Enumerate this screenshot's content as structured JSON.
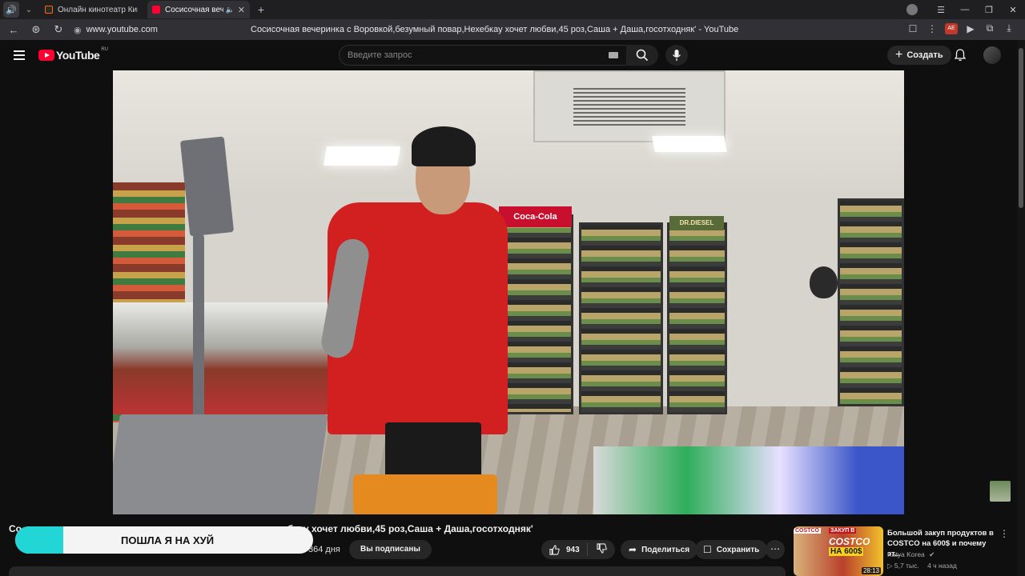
{
  "browser": {
    "tabs": [
      {
        "title": "Онлайн кинотеатр Кинопоиск",
        "active": false
      },
      {
        "title": "Сосисочная вечеринка",
        "active": true
      }
    ],
    "url": "www.youtube.com",
    "page_title": "Сосисочная вечеринка с Воровкой,безумный повар,Нехебкау хочет любви,45 роз,Саша + Даша,госотходняк' - YouTube",
    "extension_badge": "AE"
  },
  "masthead": {
    "logo_text": "YouTube",
    "region": "RU",
    "search_placeholder": "Введите запрос",
    "create_label": "Создать"
  },
  "video": {
    "title": "Сосисочная вечеринка с Воровкой,безумный повар,Нехебкау хочет любви,45 роз,Саша + Даша,госотходняк'",
    "title_visible_start": "Со",
    "title_visible_tail": "ребкау хочет любви,45 роз,Саша + Даша,госотходняк'",
    "overlay_text": "ПОШЛА Я НА ХУЙ",
    "age": "364 дня",
    "subscribed_label": "Вы подписаны",
    "likes": "943",
    "share_label": "Поделиться",
    "save_label": "Сохранить",
    "progress_fraction": 0.16,
    "overlay_bar_fill_fraction": 0.16
  },
  "recommendation": {
    "thumb_brand": "COSTCO",
    "thumb_line1": "ЗАКУП В",
    "thumb_line2": "COSTCO",
    "thumb_line3": "НА 600$",
    "duration": "28:13",
    "title": "Большой закуп продуктов в COSTCO на 600$ и почему эт...",
    "channel": "Katya Korea",
    "views": "5,7 тыс.",
    "posted": "4 ч назад"
  },
  "colors": {
    "yt_red": "#ff0033",
    "bg": "#0f0f0f",
    "pill": "#272727",
    "overlay_accent": "#23d6d6"
  }
}
